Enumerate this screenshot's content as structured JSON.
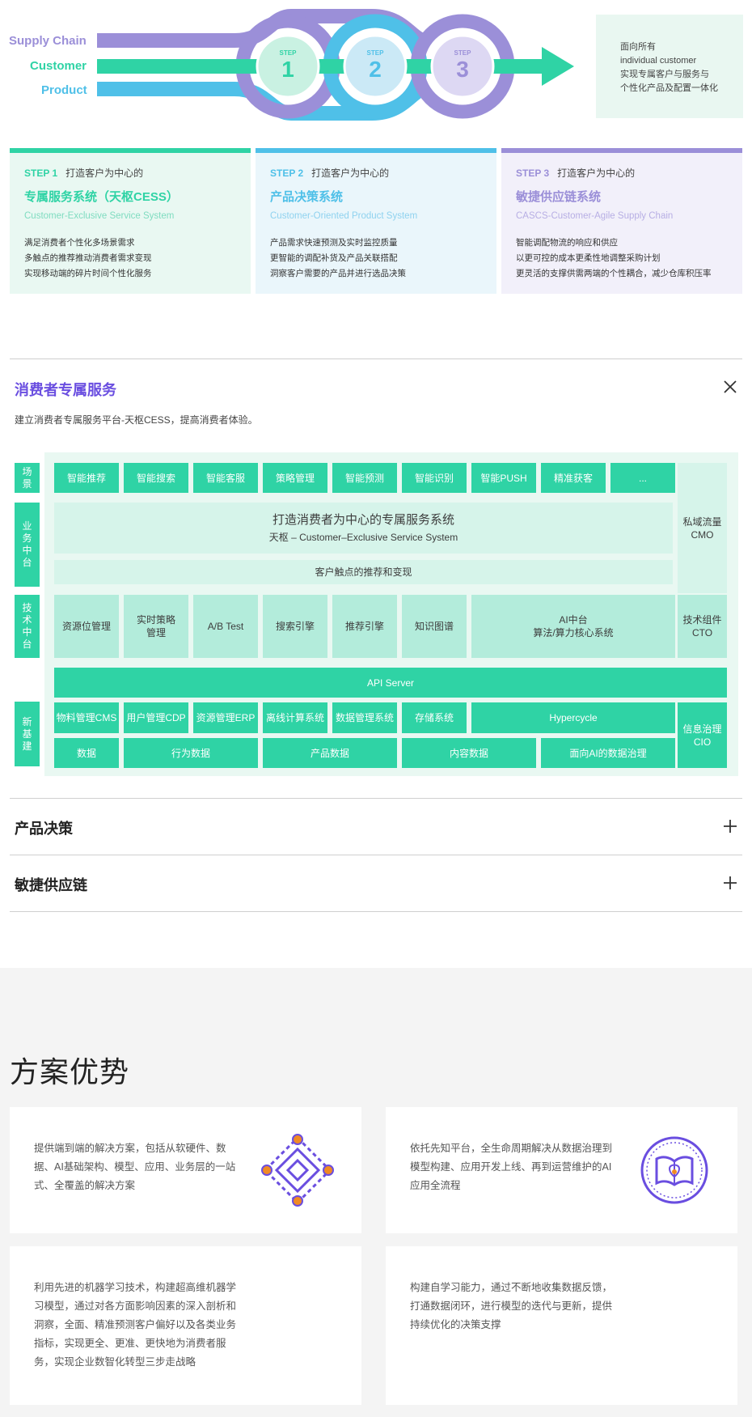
{
  "hero": {
    "labels": [
      "Supply Chain",
      "Customer",
      "Product"
    ],
    "steps": [
      {
        "tag": "STEP",
        "num": "1"
      },
      {
        "tag": "STEP",
        "num": "2"
      },
      {
        "tag": "STEP",
        "num": "3"
      }
    ],
    "note": [
      "面向所有",
      "individual customer",
      "实现专属客户与服务与",
      "个性化产品及配置一体化"
    ],
    "colors": {
      "supply": "#9b8fd8",
      "customer": "#2fd3a5",
      "product": "#4fc0e8"
    }
  },
  "step_cards": [
    {
      "step": "STEP 1",
      "head": "打造客户为中心的",
      "title": "专属服务系统（天枢CESS）",
      "subtitle": "Customer-Exclusive Service System",
      "lines": [
        "满足消费者个性化多场景需求",
        "多触点的推荐推动消费者需求变现",
        "实现移动端的碎片时间个性化服务"
      ],
      "accent": "#2fd3a5",
      "bg": "#e9f8f2"
    },
    {
      "step": "STEP 2",
      "head": "打造客户为中心的",
      "title": "产品决策系统",
      "subtitle": "Customer-Oriented Product System",
      "lines": [
        "产品需求快速预测及实时监控质量",
        "更智能的调配补货及产品关联搭配",
        "洞察客户需要的产品并进行选品决策"
      ],
      "accent": "#4fc0e8",
      "bg": "#eaf6fb"
    },
    {
      "step": "STEP 3",
      "head": "打造客户为中心的",
      "title": "敏捷供应链系统",
      "subtitle": "CASCS-Customer-Agile Supply Chain",
      "lines": [
        "智能调配物流的响应和供应",
        "以更可控的成本更柔性地调整采购计划",
        "更灵活的支撑供需两端的个性耦合，减少仓库积压率"
      ],
      "accent": "#9b8fd8",
      "bg": "#f2f0fa"
    }
  ],
  "accordion": {
    "open_title": "消费者专属服务",
    "open_desc": "建立消费者专属服务平台-天枢CESS，提高消费者体验。",
    "collapsed": [
      "产品决策",
      "敏捷供应链"
    ]
  },
  "diagram": {
    "row_labels": [
      "场景",
      "业务中台",
      "技术中台",
      "新基建"
    ],
    "scenes": [
      "智能推荐",
      "智能搜索",
      "智能客服",
      "策略管理",
      "智能预测",
      "智能识别",
      "智能PUSH",
      "精准获客",
      "..."
    ],
    "main_title": "打造消费者为中心的专属服务系统",
    "main_sub": "天枢 – Customer–Exclusive Service System",
    "touchpoint": "客户触点的推荐和变现",
    "side_private": [
      "私域流量",
      "CMO"
    ],
    "tech": [
      "资源位管理",
      "实时策略管理",
      "A/B Test",
      "搜索引擎",
      "推荐引擎",
      "知识图谱"
    ],
    "ai_center": [
      "AI中台",
      "算法/算力核心系统"
    ],
    "side_tech": [
      "技术组件",
      "CTO"
    ],
    "api": "API Server",
    "infra1": [
      "物料管理CMS",
      "用户管理CDP",
      "资源管理ERP",
      "离线计算系统",
      "数据管理系统",
      "存储系统"
    ],
    "hypercycle": "Hypercycle",
    "infra2": [
      "数据",
      "行为数据",
      "产品数据",
      "内容数据",
      "面向AI的数据治理"
    ],
    "side_info": [
      "信息治理",
      "CIO"
    ]
  },
  "advantages": {
    "title": "方案优势",
    "cards": [
      {
        "text": [
          "提供端到端的解决方案，包括从软硬件、数",
          "据、AI基础架构、模型、应用、业务层的一站",
          "式、全覆盖的解决方案"
        ],
        "icon": "diamond-network-icon"
      },
      {
        "text": [
          "依托先知平台，全生命周期解决从数据治理到",
          "模型构建、应用开发上线、再到运营维护的AI",
          "应用全流程"
        ],
        "icon": "book-badge-icon"
      },
      {
        "text": [
          "利用先进的机器学习技术，构建超高维机器学",
          "习模型，通过对各方面影响因素的深入剖析和",
          "洞察，全面、精准预测客户偏好以及各类业务",
          "指标，实现更全、更准、更快地为消费者服",
          "务，实现企业数智化转型三步走战略"
        ]
      },
      {
        "text": [
          "构建自学习能力，通过不断地收集数据反馈，",
          "打通数据闭环，进行模型的迭代与更新，提供",
          "持续优化的决策支撑"
        ]
      }
    ],
    "icon_colors": {
      "primary": "#6a4ee0",
      "secondary": "#f08a24"
    }
  }
}
